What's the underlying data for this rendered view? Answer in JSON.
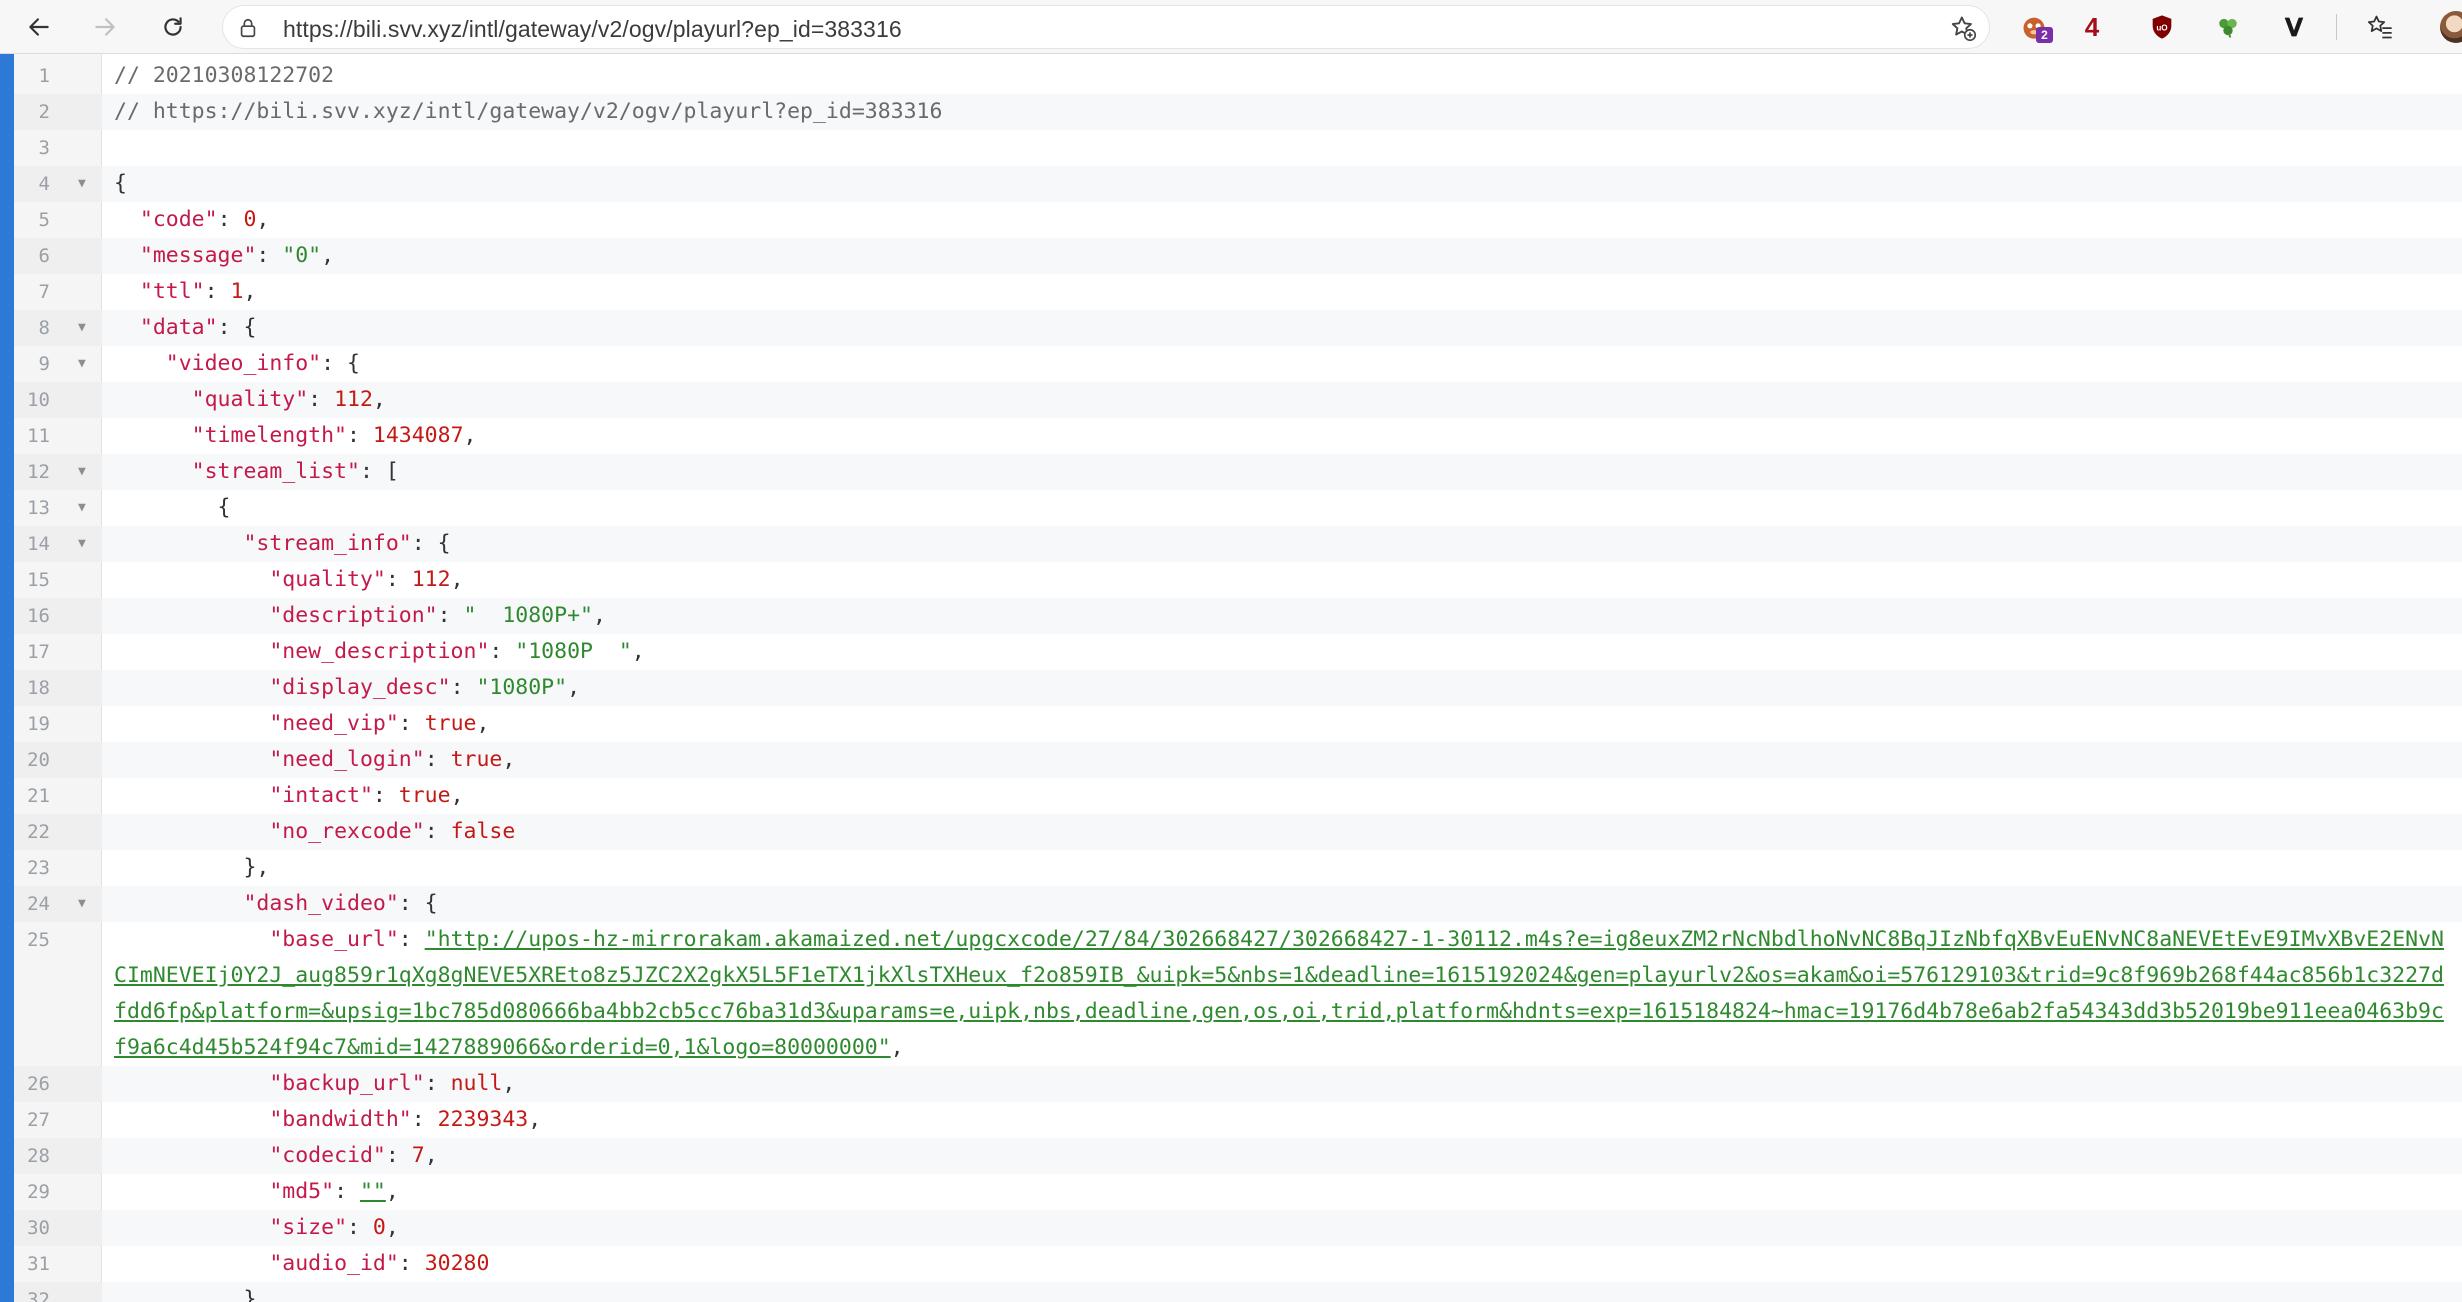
{
  "browser": {
    "url": "https://bili.svv.xyz/intl/gateway/v2/ogv/playurl?ep_id=383316",
    "extensions": [
      {
        "name": "tampermonkey-icon",
        "badge": "2"
      },
      {
        "name": "number-extension",
        "label": "4"
      },
      {
        "name": "ublock-icon"
      },
      {
        "name": "clover-icon"
      },
      {
        "name": "vimium-icon",
        "label": "V"
      }
    ],
    "colors": {
      "accent": "#2d7ad6",
      "key": "#c41a4a",
      "string": "#2f8a2f",
      "number": "#c41a16"
    }
  },
  "lines": [
    {
      "n": "1",
      "fold": "",
      "tokens": [
        [
          "comment",
          "// 20210308122702"
        ]
      ]
    },
    {
      "n": "2",
      "fold": "",
      "tokens": [
        [
          "comment",
          "// https://bili.svv.xyz/intl/gateway/v2/ogv/playurl?ep_id=383316"
        ]
      ]
    },
    {
      "n": "3",
      "fold": "",
      "tokens": []
    },
    {
      "n": "4",
      "fold": "▼",
      "tokens": [
        [
          "punc",
          "{"
        ]
      ]
    },
    {
      "n": "5",
      "fold": "",
      "tokens": [
        [
          "punc",
          "  "
        ],
        [
          "key",
          "\"code\""
        ],
        [
          "punc",
          ": "
        ],
        [
          "num",
          "0"
        ],
        [
          "punc",
          ","
        ]
      ]
    },
    {
      "n": "6",
      "fold": "",
      "tokens": [
        [
          "punc",
          "  "
        ],
        [
          "key",
          "\"message\""
        ],
        [
          "punc",
          ": "
        ],
        [
          "str",
          "\"0\""
        ],
        [
          "punc",
          ","
        ]
      ]
    },
    {
      "n": "7",
      "fold": "",
      "tokens": [
        [
          "punc",
          "  "
        ],
        [
          "key",
          "\"ttl\""
        ],
        [
          "punc",
          ": "
        ],
        [
          "num",
          "1"
        ],
        [
          "punc",
          ","
        ]
      ]
    },
    {
      "n": "8",
      "fold": "▼",
      "tokens": [
        [
          "punc",
          "  "
        ],
        [
          "key",
          "\"data\""
        ],
        [
          "punc",
          ": {"
        ]
      ]
    },
    {
      "n": "9",
      "fold": "▼",
      "tokens": [
        [
          "punc",
          "    "
        ],
        [
          "key",
          "\"video_info\""
        ],
        [
          "punc",
          ": {"
        ]
      ]
    },
    {
      "n": "10",
      "fold": "",
      "tokens": [
        [
          "punc",
          "      "
        ],
        [
          "key",
          "\"quality\""
        ],
        [
          "punc",
          ": "
        ],
        [
          "num",
          "112"
        ],
        [
          "punc",
          ","
        ]
      ]
    },
    {
      "n": "11",
      "fold": "",
      "tokens": [
        [
          "punc",
          "      "
        ],
        [
          "key",
          "\"timelength\""
        ],
        [
          "punc",
          ": "
        ],
        [
          "num",
          "1434087"
        ],
        [
          "punc",
          ","
        ]
      ]
    },
    {
      "n": "12",
      "fold": "▼",
      "tokens": [
        [
          "punc",
          "      "
        ],
        [
          "key",
          "\"stream_list\""
        ],
        [
          "punc",
          ": ["
        ]
      ]
    },
    {
      "n": "13",
      "fold": "▼",
      "tokens": [
        [
          "punc",
          "        {"
        ]
      ]
    },
    {
      "n": "14",
      "fold": "▼",
      "tokens": [
        [
          "punc",
          "          "
        ],
        [
          "key",
          "\"stream_info\""
        ],
        [
          "punc",
          ": {"
        ]
      ]
    },
    {
      "n": "15",
      "fold": "",
      "tokens": [
        [
          "punc",
          "            "
        ],
        [
          "key",
          "\"quality\""
        ],
        [
          "punc",
          ": "
        ],
        [
          "num",
          "112"
        ],
        [
          "punc",
          ","
        ]
      ]
    },
    {
      "n": "16",
      "fold": "",
      "tokens": [
        [
          "punc",
          "            "
        ],
        [
          "key",
          "\"description\""
        ],
        [
          "punc",
          ": "
        ],
        [
          "str",
          "\"  1080P+\""
        ],
        [
          "punc",
          ","
        ]
      ]
    },
    {
      "n": "17",
      "fold": "",
      "tokens": [
        [
          "punc",
          "            "
        ],
        [
          "key",
          "\"new_description\""
        ],
        [
          "punc",
          ": "
        ],
        [
          "str",
          "\"1080P  \""
        ],
        [
          "punc",
          ","
        ]
      ]
    },
    {
      "n": "18",
      "fold": "",
      "tokens": [
        [
          "punc",
          "            "
        ],
        [
          "key",
          "\"display_desc\""
        ],
        [
          "punc",
          ": "
        ],
        [
          "str",
          "\"1080P\""
        ],
        [
          "punc",
          ","
        ]
      ]
    },
    {
      "n": "19",
      "fold": "",
      "tokens": [
        [
          "punc",
          "            "
        ],
        [
          "key",
          "\"need_vip\""
        ],
        [
          "punc",
          ": "
        ],
        [
          "bool",
          "true"
        ],
        [
          "punc",
          ","
        ]
      ]
    },
    {
      "n": "20",
      "fold": "",
      "tokens": [
        [
          "punc",
          "            "
        ],
        [
          "key",
          "\"need_login\""
        ],
        [
          "punc",
          ": "
        ],
        [
          "bool",
          "true"
        ],
        [
          "punc",
          ","
        ]
      ]
    },
    {
      "n": "21",
      "fold": "",
      "tokens": [
        [
          "punc",
          "            "
        ],
        [
          "key",
          "\"intact\""
        ],
        [
          "punc",
          ": "
        ],
        [
          "bool",
          "true"
        ],
        [
          "punc",
          ","
        ]
      ]
    },
    {
      "n": "22",
      "fold": "",
      "tokens": [
        [
          "punc",
          "            "
        ],
        [
          "key",
          "\"no_rexcode\""
        ],
        [
          "punc",
          ": "
        ],
        [
          "bool",
          "false"
        ]
      ]
    },
    {
      "n": "23",
      "fold": "",
      "tokens": [
        [
          "punc",
          "          },"
        ]
      ]
    },
    {
      "n": "24",
      "fold": "▼",
      "tokens": [
        [
          "punc",
          "          "
        ],
        [
          "key",
          "\"dash_video\""
        ],
        [
          "punc",
          ": {"
        ]
      ]
    },
    {
      "n": "25",
      "fold": "",
      "wrap": true,
      "tokens": [
        [
          "punc",
          "            "
        ],
        [
          "key",
          "\"base_url\""
        ],
        [
          "punc",
          ": "
        ],
        [
          "link",
          "\"http://upos-hz-mirrorakam.akamaized.net/upgcxcode/27/84/302668427/302668427-1-30112.m4s?e=ig8euxZM2rNcNbdlhoNvNC8BqJIzNbfqXBvEuENvNC8aNEVEtEvE9IMvXBvE2ENvNCImNEVEIj0Y2J_aug859r1qXg8gNEVE5XREto8z5JZC2X2gkX5L5F1eTX1jkXlsTXHeux_f2o859IB_&uipk=5&nbs=1&deadline=1615192024&gen=playurlv2&os=akam&oi=576129103&trid=9c8f969b268f44ac856b1c3227dfdd6fp&platform=&upsig=1bc785d080666ba4bb2cb5cc76ba31d3&uparams=e,uipk,nbs,deadline,gen,os,oi,trid,platform&hdnts=exp=1615184824~hmac=19176d4b78e6ab2fa54343dd3b52019be911eea0463b9cf9a6c4d45b524f94c7&mid=1427889066&orderid=0,1&logo=80000000\""
        ],
        [
          "punc",
          ","
        ]
      ]
    },
    {
      "n": "26",
      "fold": "",
      "tokens": [
        [
          "punc",
          "            "
        ],
        [
          "key",
          "\"backup_url\""
        ],
        [
          "punc",
          ": "
        ],
        [
          "bool",
          "null"
        ],
        [
          "punc",
          ","
        ]
      ]
    },
    {
      "n": "27",
      "fold": "",
      "tokens": [
        [
          "punc",
          "            "
        ],
        [
          "key",
          "\"bandwidth\""
        ],
        [
          "punc",
          ": "
        ],
        [
          "num",
          "2239343"
        ],
        [
          "punc",
          ","
        ]
      ]
    },
    {
      "n": "28",
      "fold": "",
      "tokens": [
        [
          "punc",
          "            "
        ],
        [
          "key",
          "\"codecid\""
        ],
        [
          "punc",
          ": "
        ],
        [
          "num",
          "7"
        ],
        [
          "punc",
          ","
        ]
      ]
    },
    {
      "n": "29",
      "fold": "",
      "tokens": [
        [
          "punc",
          "            "
        ],
        [
          "key",
          "\"md5\""
        ],
        [
          "punc",
          ": "
        ],
        [
          "link",
          "\"\""
        ],
        [
          "punc",
          ","
        ]
      ]
    },
    {
      "n": "30",
      "fold": "",
      "tokens": [
        [
          "punc",
          "            "
        ],
        [
          "key",
          "\"size\""
        ],
        [
          "punc",
          ": "
        ],
        [
          "num",
          "0"
        ],
        [
          "punc",
          ","
        ]
      ]
    },
    {
      "n": "31",
      "fold": "",
      "tokens": [
        [
          "punc",
          "            "
        ],
        [
          "key",
          "\"audio_id\""
        ],
        [
          "punc",
          ": "
        ],
        [
          "num",
          "30280"
        ]
      ]
    },
    {
      "n": "32",
      "fold": "",
      "tokens": [
        [
          "punc",
          "          }"
        ]
      ]
    }
  ]
}
